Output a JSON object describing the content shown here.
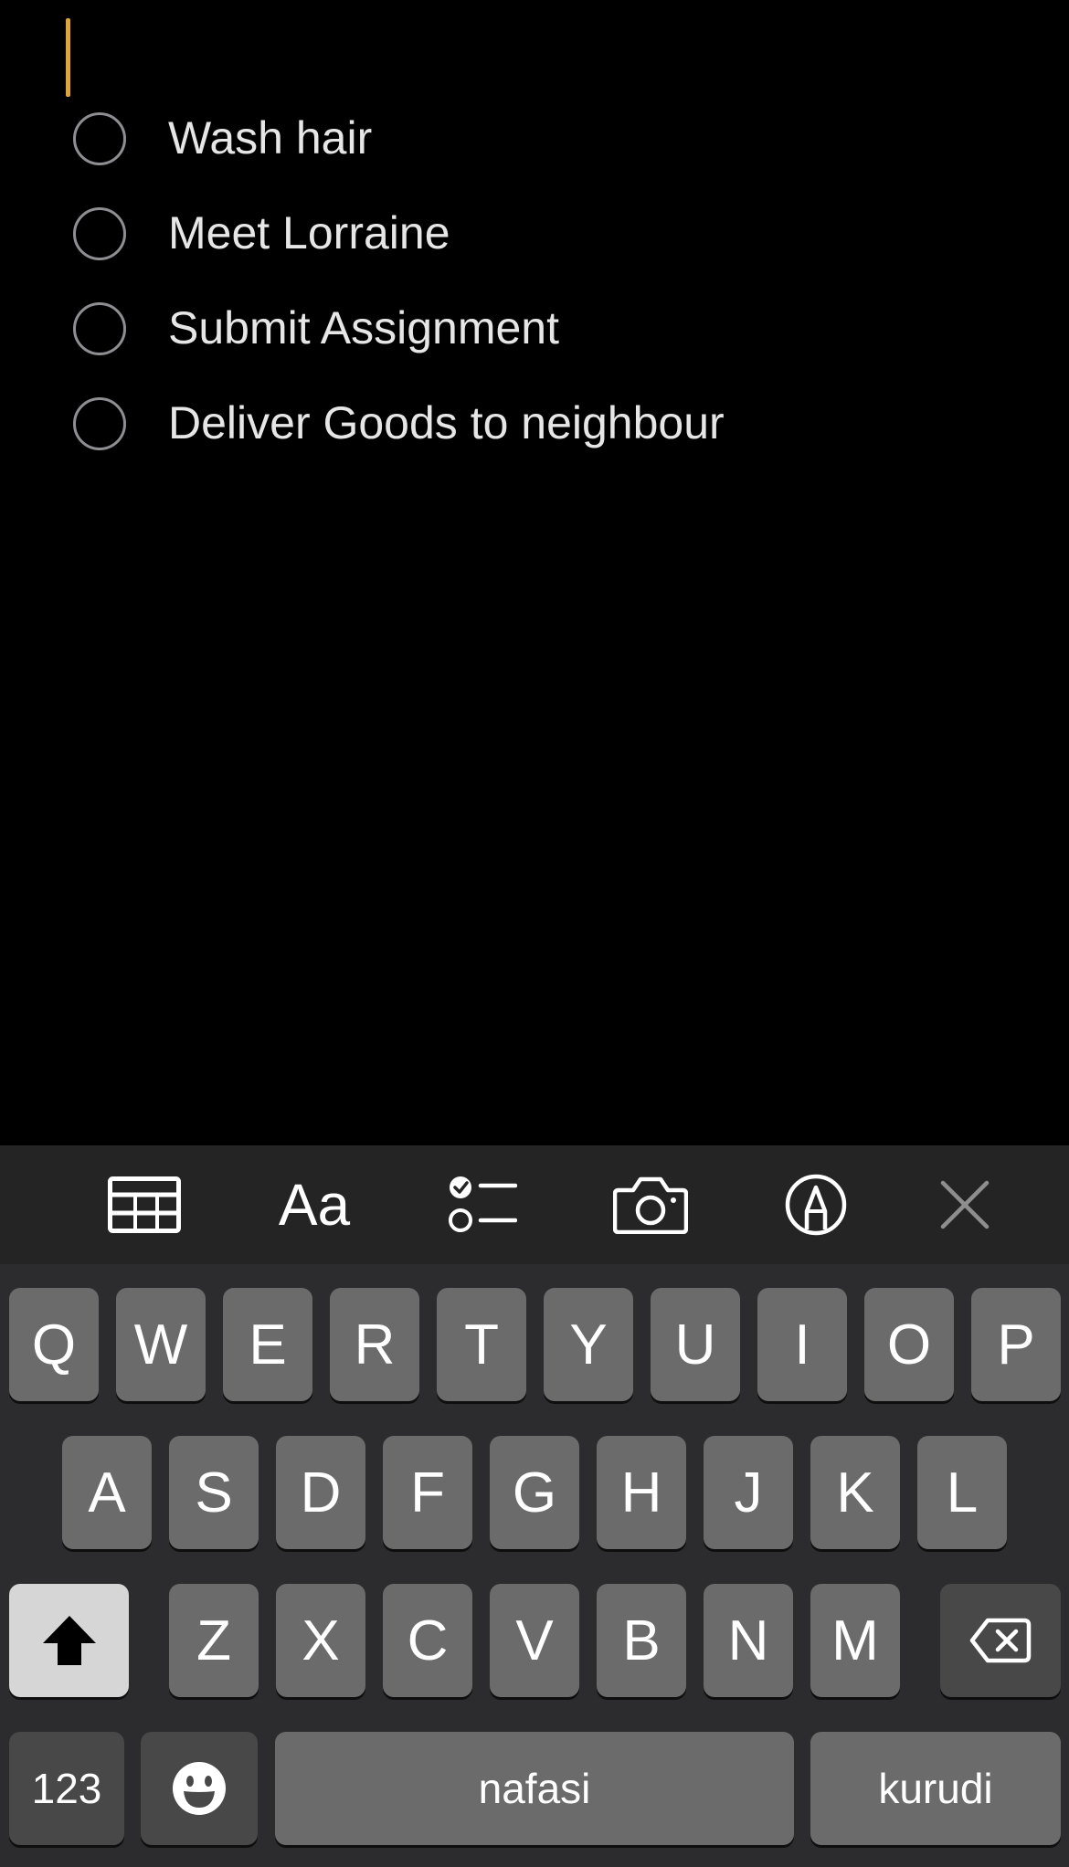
{
  "note": {
    "checklist": [
      {
        "label": "Wash hair",
        "checked": false
      },
      {
        "label": "Meet Lorraine",
        "checked": false
      },
      {
        "label": "Submit Assignment",
        "checked": false
      },
      {
        "label": "Deliver Goods to neighbour",
        "checked": false
      }
    ],
    "cursor_color": "#e0a53a"
  },
  "toolbar": {
    "items": [
      "table-icon",
      "text-format-icon",
      "checklist-icon",
      "camera-icon",
      "markup-pen-icon",
      "close-icon"
    ],
    "format_label": "Aa"
  },
  "keyboard": {
    "row1": [
      "Q",
      "W",
      "E",
      "R",
      "T",
      "Y",
      "U",
      "I",
      "O",
      "P"
    ],
    "row2": [
      "A",
      "S",
      "D",
      "F",
      "G",
      "H",
      "J",
      "K",
      "L"
    ],
    "row3": [
      "Z",
      "X",
      "C",
      "V",
      "B",
      "N",
      "M"
    ],
    "numbers_label": "123",
    "space_label": "nafasi",
    "return_label": "kurudi",
    "shift_icon": "shift-icon",
    "delete_icon": "backspace-icon",
    "emoji_icon": "emoji-icon"
  }
}
